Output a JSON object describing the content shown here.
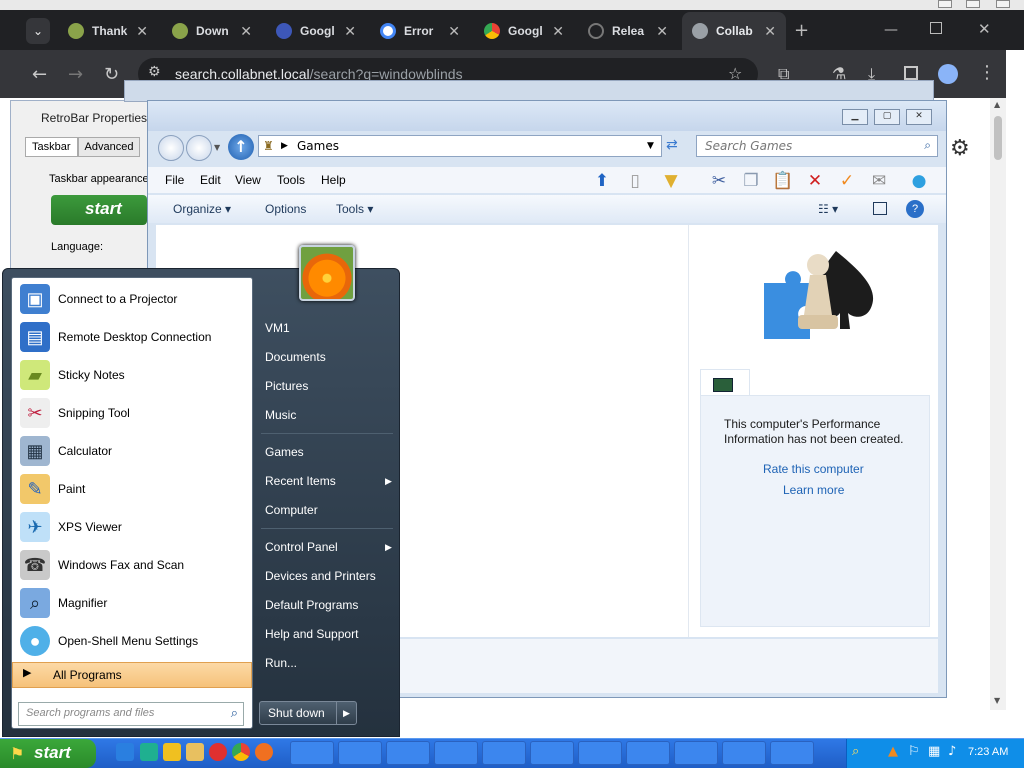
{
  "chrome": {
    "tabs": [
      {
        "label": "Thank",
        "color": "#8aa34a"
      },
      {
        "label": "Down",
        "color": "#8aa34a"
      },
      {
        "label": "Googl",
        "color": "#3d57b8"
      },
      {
        "label": "Error",
        "color": "#4285f4"
      },
      {
        "label": "Googl",
        "color": "#34a853"
      },
      {
        "label": "Relea",
        "color": "#202124"
      },
      {
        "label": "Collab",
        "color": "#9aa0a6"
      }
    ],
    "url_host": "search.collabnet.local",
    "url_path": "/search?q=windowblinds",
    "new_tab": "+",
    "close_tab": "✕"
  },
  "retrobar": {
    "title": "RetroBar Properties",
    "tabs": [
      "Taskbar",
      "Advanced"
    ],
    "appearance_label": "Taskbar appearance",
    "start_label": "start",
    "language_label": "Language:"
  },
  "explorer": {
    "address": "Games",
    "search_placeholder": "Search Games",
    "menu": [
      "File",
      "Edit",
      "View",
      "Tools",
      "Help"
    ],
    "commands": {
      "organize": "Organize",
      "options": "Options",
      "tools": "Tools"
    },
    "perf_text": "This computer's Performance Information has not been created.",
    "rate_link": "Rate this computer",
    "learn_link": "Learn more"
  },
  "startmenu": {
    "programs": [
      {
        "label": "Connect to a Projector",
        "icon": "projector-icon",
        "color": "#3f7fd0"
      },
      {
        "label": "Remote Desktop Connection",
        "icon": "remote-desktop-icon",
        "color": "#2f6fc8"
      },
      {
        "label": "Sticky Notes",
        "icon": "sticky-notes-icon",
        "color": "#cfe87a"
      },
      {
        "label": "Snipping Tool",
        "icon": "scissors-icon",
        "color": "#e8e8e8"
      },
      {
        "label": "Calculator",
        "icon": "calculator-icon",
        "color": "#9fb6d0"
      },
      {
        "label": "Paint",
        "icon": "paint-icon",
        "color": "#f2c86a"
      },
      {
        "label": "XPS Viewer",
        "icon": "xps-icon",
        "color": "#bfe0f8"
      },
      {
        "label": "Windows Fax and Scan",
        "icon": "fax-icon",
        "color": "#c9c9c9"
      },
      {
        "label": "Magnifier",
        "icon": "magnifier-icon",
        "color": "#7aa9e0"
      },
      {
        "label": "Open-Shell Menu Settings",
        "icon": "shell-icon",
        "color": "#4fb0e8"
      }
    ],
    "all_programs": "All Programs",
    "search_placeholder": "Search programs and files",
    "right_group1": [
      "VM1",
      "Documents",
      "Pictures",
      "Music"
    ],
    "right_group2": [
      "Games",
      "Recent Items",
      "Computer"
    ],
    "right_group3": [
      "Control Panel",
      "Devices and Printers",
      "Default Programs",
      "Help and Support",
      "Run..."
    ],
    "shutdown": "Shut down"
  },
  "taskbar": {
    "start_label": "start",
    "clock": "7:23 AM"
  }
}
